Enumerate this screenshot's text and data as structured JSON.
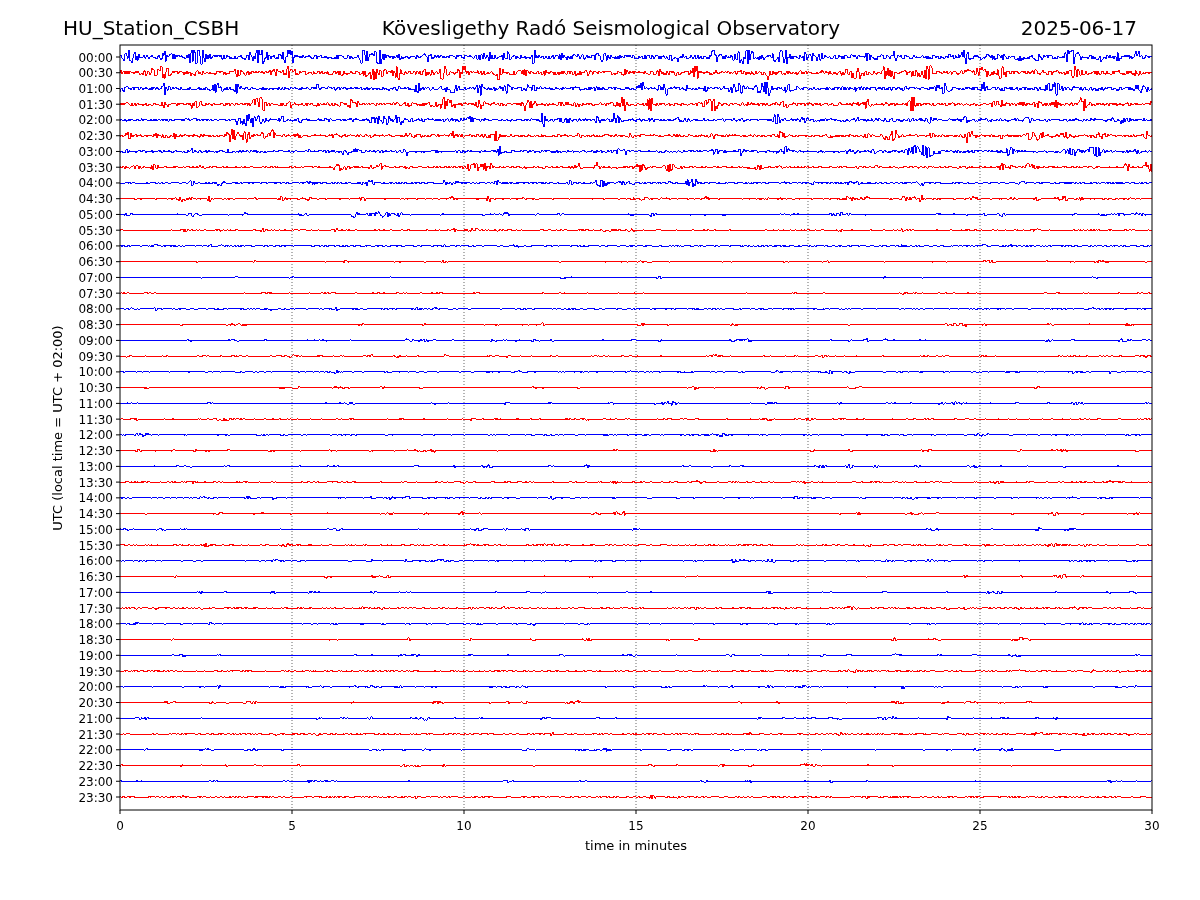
{
  "header": {
    "station": "HU_Station_CSBH",
    "observatory": "Kövesligethy Radó Seismological Observatory",
    "date": "2025-06-17"
  },
  "plot": {
    "ylabel": "UTC (local time = UTC + 02:00)",
    "xlabel": "time in minutes",
    "xticks": [
      "0",
      "5",
      "10",
      "15",
      "20",
      "25",
      "30"
    ],
    "rows": [
      {
        "label": "00:00",
        "color": "#0000ff"
      },
      {
        "label": "00:30",
        "color": "#ff0000"
      },
      {
        "label": "01:00",
        "color": "#0000ff"
      },
      {
        "label": "01:30",
        "color": "#ff0000"
      },
      {
        "label": "02:00",
        "color": "#0000ff"
      },
      {
        "label": "02:30",
        "color": "#ff0000"
      },
      {
        "label": "03:00",
        "color": "#0000ff"
      },
      {
        "label": "03:30",
        "color": "#ff0000"
      },
      {
        "label": "04:00",
        "color": "#0000ff"
      },
      {
        "label": "04:30",
        "color": "#ff0000"
      },
      {
        "label": "05:00",
        "color": "#0000ff"
      },
      {
        "label": "05:30",
        "color": "#ff0000"
      },
      {
        "label": "06:00",
        "color": "#0000ff"
      },
      {
        "label": "06:30",
        "color": "#ff0000"
      },
      {
        "label": "07:00",
        "color": "#0000ff"
      },
      {
        "label": "07:30",
        "color": "#ff0000"
      },
      {
        "label": "08:00",
        "color": "#0000ff"
      },
      {
        "label": "08:30",
        "color": "#ff0000"
      },
      {
        "label": "09:00",
        "color": "#0000ff"
      },
      {
        "label": "09:30",
        "color": "#ff0000"
      },
      {
        "label": "10:00",
        "color": "#0000ff"
      },
      {
        "label": "10:30",
        "color": "#ff0000"
      },
      {
        "label": "11:00",
        "color": "#0000ff"
      },
      {
        "label": "11:30",
        "color": "#ff0000"
      },
      {
        "label": "12:00",
        "color": "#0000ff"
      },
      {
        "label": "12:30",
        "color": "#ff0000"
      },
      {
        "label": "13:00",
        "color": "#0000ff"
      },
      {
        "label": "13:30",
        "color": "#ff0000"
      },
      {
        "label": "14:00",
        "color": "#0000ff"
      },
      {
        "label": "14:30",
        "color": "#ff0000"
      },
      {
        "label": "15:00",
        "color": "#0000ff"
      },
      {
        "label": "15:30",
        "color": "#ff0000"
      },
      {
        "label": "16:00",
        "color": "#0000ff"
      },
      {
        "label": "16:30",
        "color": "#ff0000"
      },
      {
        "label": "17:00",
        "color": "#0000ff"
      },
      {
        "label": "17:30",
        "color": "#ff0000"
      },
      {
        "label": "18:00",
        "color": "#0000ff"
      },
      {
        "label": "18:30",
        "color": "#ff0000"
      },
      {
        "label": "19:00",
        "color": "#0000ff"
      },
      {
        "label": "19:30",
        "color": "#ff0000"
      },
      {
        "label": "20:00",
        "color": "#0000ff"
      },
      {
        "label": "20:30",
        "color": "#ff0000"
      },
      {
        "label": "21:00",
        "color": "#0000ff"
      },
      {
        "label": "21:30",
        "color": "#ff0000"
      },
      {
        "label": "22:00",
        "color": "#0000ff"
      },
      {
        "label": "22:30",
        "color": "#ff0000"
      },
      {
        "label": "23:00",
        "color": "#0000ff"
      },
      {
        "label": "23:30",
        "color": "#ff0000"
      }
    ]
  }
}
